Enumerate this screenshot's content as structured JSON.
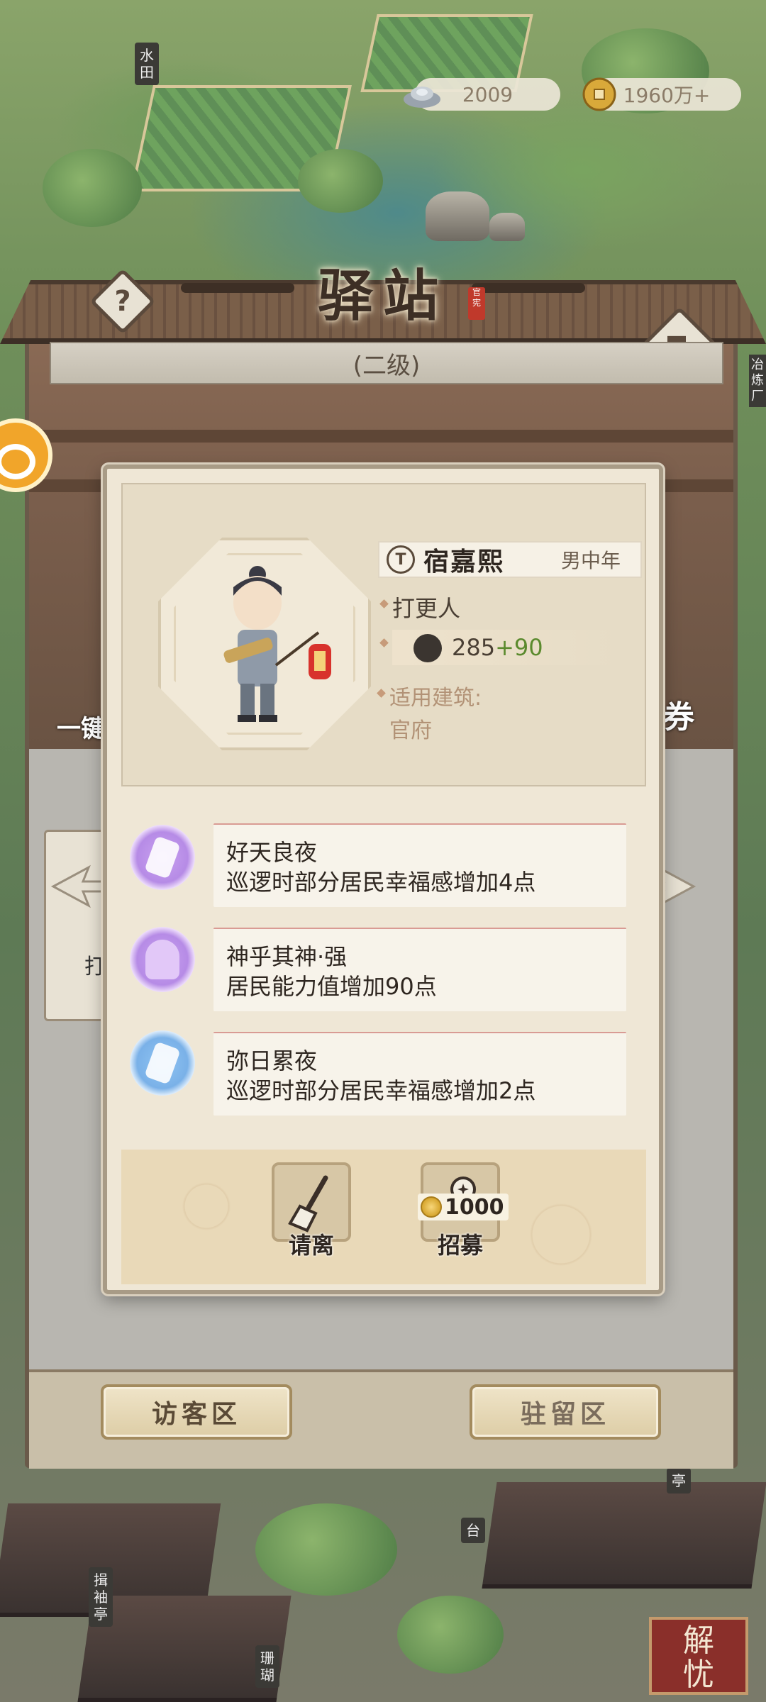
{
  "map": {
    "labels": [
      "水田",
      "冶炼厂",
      "揖袖亭",
      "台",
      "亭",
      "珊瑚"
    ]
  },
  "currency": {
    "silver": "2009",
    "coins": "1960万+"
  },
  "station": {
    "title": "驿站",
    "seal": "官宪",
    "level": "(二级)",
    "left_fragment": "一键",
    "right_fragment": "券",
    "under_card_fragment": "打"
  },
  "resident": {
    "name": "宿嘉熙",
    "gender_age": "男中年",
    "occupation": "打更人",
    "power_base": "285",
    "power_bonus": "+90",
    "apply_label": "适用建筑:",
    "apply_building": "官府"
  },
  "skills": [
    {
      "name": "好天良夜",
      "desc": "巡逻时部分居民幸福感增加4点",
      "icon": "purple-lantern-icon"
    },
    {
      "name": "神乎其神·强",
      "desc": "居民能力值增加90点",
      "icon": "buddha-icon"
    },
    {
      "name": "弥日累夜",
      "desc": "巡逻时部分居民幸福感增加2点",
      "icon": "blue-lantern-icon"
    }
  ],
  "actions": {
    "dismiss_label": "请离",
    "recruit_label": "招募",
    "recruit_cost": "1000"
  },
  "tabs": {
    "visitor": "访客区",
    "resident": "驻留区"
  },
  "corner_badge": "解忧"
}
